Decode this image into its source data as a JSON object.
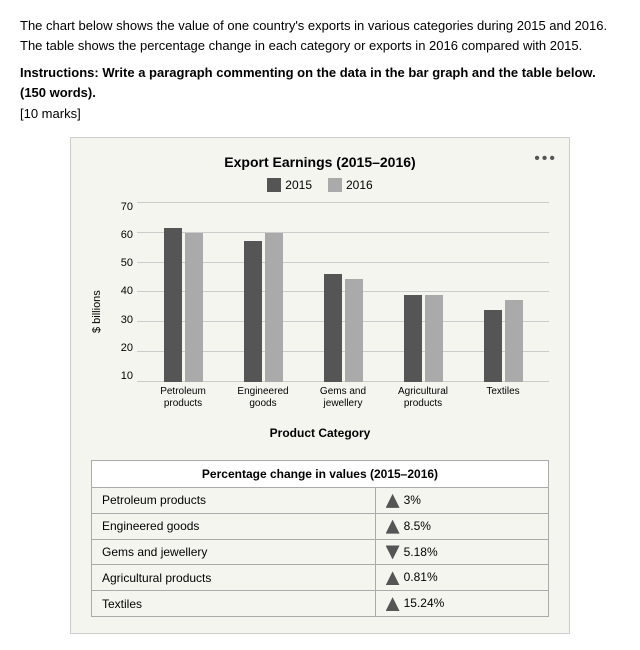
{
  "intro": {
    "text1": "The chart below shows the value of one country's exports in various categories during 2015 and 2016. The table shows the percentage change in each category or exports in 2016 compared with 2015.",
    "instructions": "Instructions: Write a paragraph commenting on the data in the bar graph and the table below. (150 words).",
    "marks": "[10 marks]"
  },
  "chart": {
    "title": "Export Earnings (2015–2016)",
    "legend": {
      "2015_label": "2015",
      "2016_label": "2016",
      "2015_color": "#666",
      "2016_color": "#999"
    },
    "y_axis_label": "$ billions",
    "x_axis_title": "Product Category",
    "y_ticks": [
      "70",
      "60",
      "50",
      "40",
      "30",
      "20",
      "10"
    ],
    "categories": [
      {
        "name": "Petroleum\nproducts",
        "label_line1": "Petroleum",
        "label_line2": "products",
        "val_2015": 60,
        "val_2016": 58
      },
      {
        "name": "Engineered\ngoods",
        "label_line1": "Engineered",
        "label_line2": "goods",
        "val_2015": 55,
        "val_2016": 58
      },
      {
        "name": "Gems and\njewellery",
        "label_line1": "Gems and",
        "label_line2": "jewellery",
        "val_2015": 42,
        "val_2016": 40
      },
      {
        "name": "Agricultural\nproducts",
        "label_line1": "Agricultural",
        "label_line2": "products",
        "val_2015": 34,
        "val_2016": 34
      },
      {
        "name": "Textiles",
        "label_line1": "Textiles",
        "label_line2": "",
        "val_2015": 28,
        "val_2016": 32
      }
    ]
  },
  "table": {
    "header": "Percentage change in values (2015–2016)",
    "rows": [
      {
        "category": "Petroleum products",
        "direction": "up",
        "value": "3%"
      },
      {
        "category": "Engineered goods",
        "direction": "up",
        "value": "8.5%"
      },
      {
        "category": "Gems and jewellery",
        "direction": "down",
        "value": "5.18%"
      },
      {
        "category": "Agricultural products",
        "direction": "up",
        "value": "0.81%"
      },
      {
        "category": "Textiles",
        "direction": "up",
        "value": "15.24%"
      }
    ]
  }
}
